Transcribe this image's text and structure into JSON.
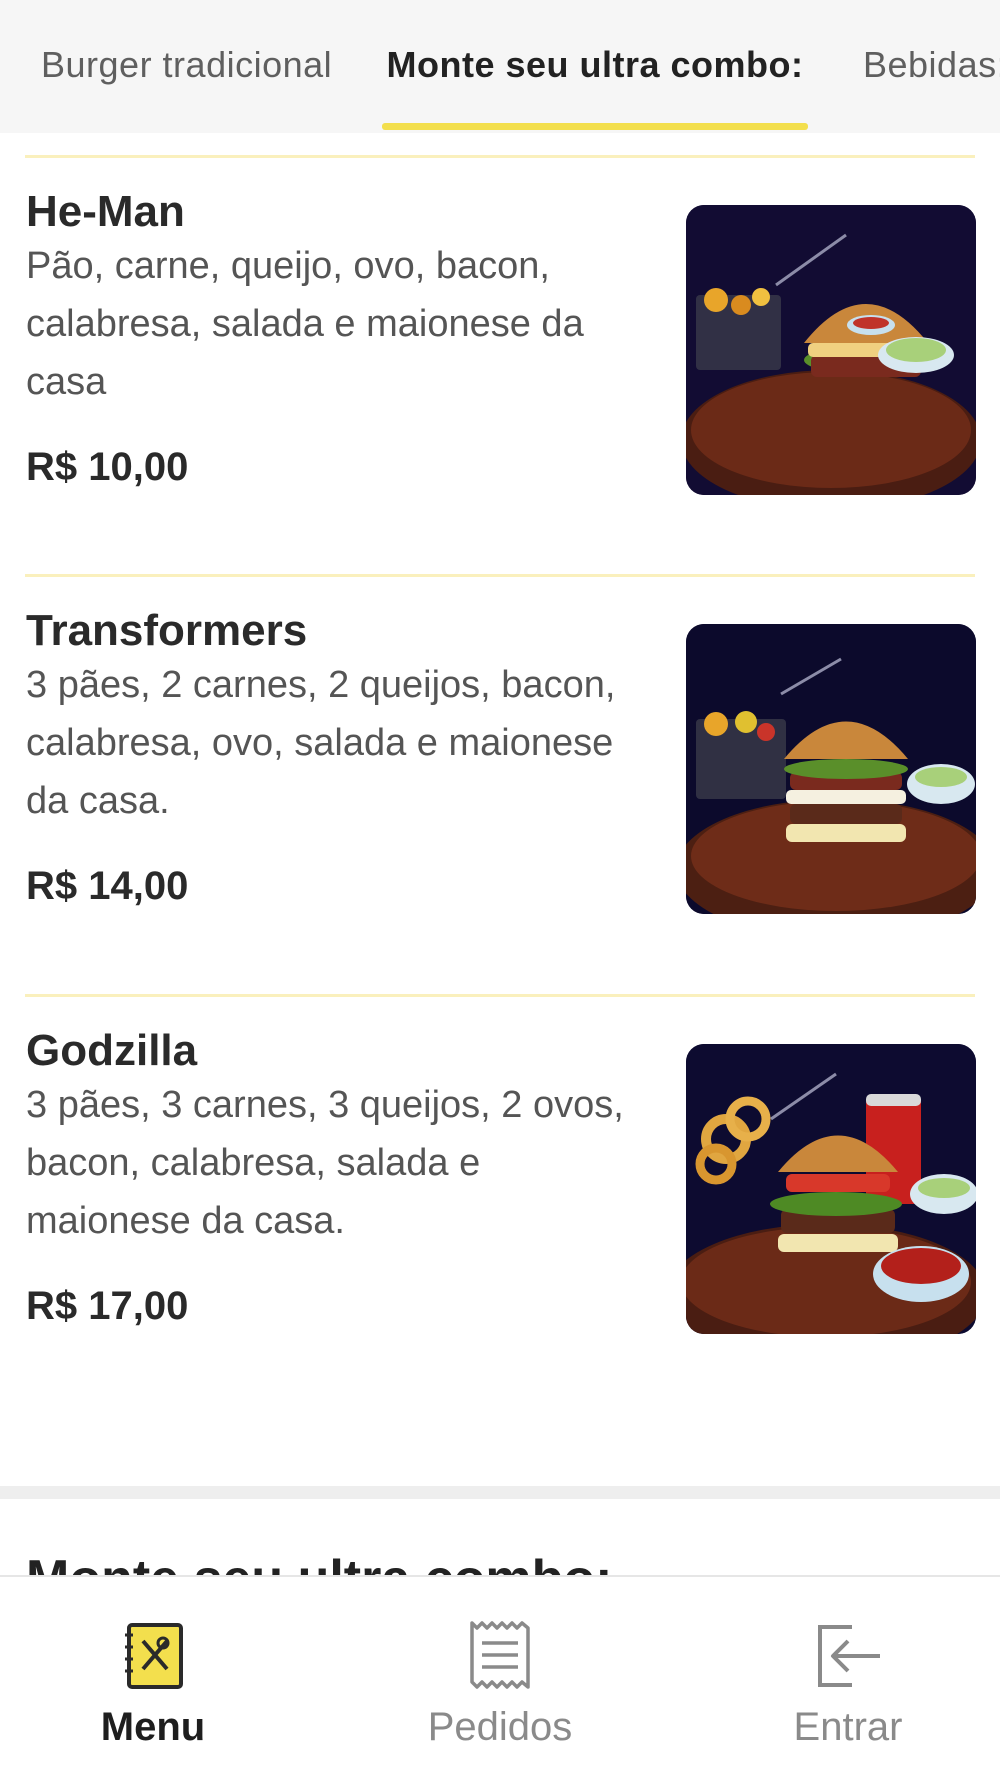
{
  "tabs": [
    {
      "label": "Burger tradicional",
      "active": false
    },
    {
      "label": "Monte seu ultra combo:",
      "active": true
    },
    {
      "label": "Bebidas:",
      "active": false
    }
  ],
  "items": [
    {
      "name": "He-Man",
      "description": "Pão, carne, queijo, ovo, bacon, calabresa, salada e maionese da casa",
      "price": "R$ 10,00"
    },
    {
      "name": "Transformers",
      "description": "3 pães, 2 carnes, 2 queijos, bacon, calabresa, ovo, salada e maionese da casa.",
      "price": "R$ 14,00"
    },
    {
      "name": "Godzilla",
      "description": "3 pães, 3 carnes, 3 queijos, 2 ovos, bacon, calabresa, salada e maionese da casa.",
      "price": "R$ 17,00"
    }
  ],
  "next_section_heading": "Monte seu ultra combo:",
  "bottom_nav": [
    {
      "label": "Menu",
      "icon": "menu-book-icon",
      "active": true
    },
    {
      "label": "Pedidos",
      "icon": "receipt-icon",
      "active": false
    },
    {
      "label": "Entrar",
      "icon": "login-arrow-icon",
      "active": false
    }
  ],
  "colors": {
    "accent": "#f3df4d",
    "divider": "#faf0bd",
    "tab_background": "#f6f6f6"
  }
}
